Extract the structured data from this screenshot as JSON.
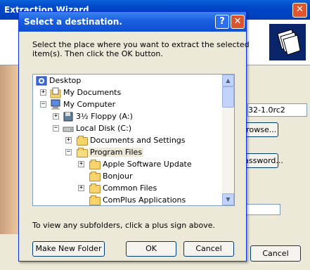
{
  "wizard": {
    "title": "Extraction Wizard",
    "field_value": "32-1.0rc2",
    "browse_label": "Browse...",
    "password_label": "Password...",
    "cancel_label": "Cancel"
  },
  "dialog": {
    "title": "Select a destination.",
    "help_glyph": "?",
    "close_glyph": "✕",
    "instruction_line1": "Select the place where you want to extract the selected",
    "instruction_line2": "item(s).  Then click the OK button.",
    "hint": "To view any subfolders, click a plus sign above.",
    "buttons": {
      "new_folder": "Make New Folder",
      "ok": "OK",
      "cancel": "Cancel"
    },
    "tree": [
      {
        "label": "Desktop",
        "icon": "desktop-icon",
        "expander": ""
      },
      {
        "label": "My Documents",
        "icon": "my-documents-icon",
        "expander": "+"
      },
      {
        "label": "My Computer",
        "icon": "my-computer-icon",
        "expander": "−"
      },
      {
        "label": "3½ Floppy (A:)",
        "icon": "floppy-drive-icon",
        "expander": "+"
      },
      {
        "label": "Local Disk (C:)",
        "icon": "hard-drive-icon",
        "expander": "−"
      },
      {
        "label": "Documents and Settings",
        "icon": "folder-icon",
        "expander": "+"
      },
      {
        "label": "Program Files",
        "icon": "folder-open-icon",
        "expander": "−",
        "selected": true
      },
      {
        "label": "Apple Software Update",
        "icon": "folder-icon",
        "expander": "+"
      },
      {
        "label": "Bonjour",
        "icon": "folder-icon",
        "expander": ""
      },
      {
        "label": "Common Files",
        "icon": "folder-icon",
        "expander": "+"
      },
      {
        "label": "ComPlus Applications",
        "icon": "folder-icon",
        "expander": ""
      }
    ]
  },
  "colors": {
    "titlebar": "#0a5fd8",
    "dialog_bg": "#ece9d8",
    "selection": "#ece9d8"
  }
}
